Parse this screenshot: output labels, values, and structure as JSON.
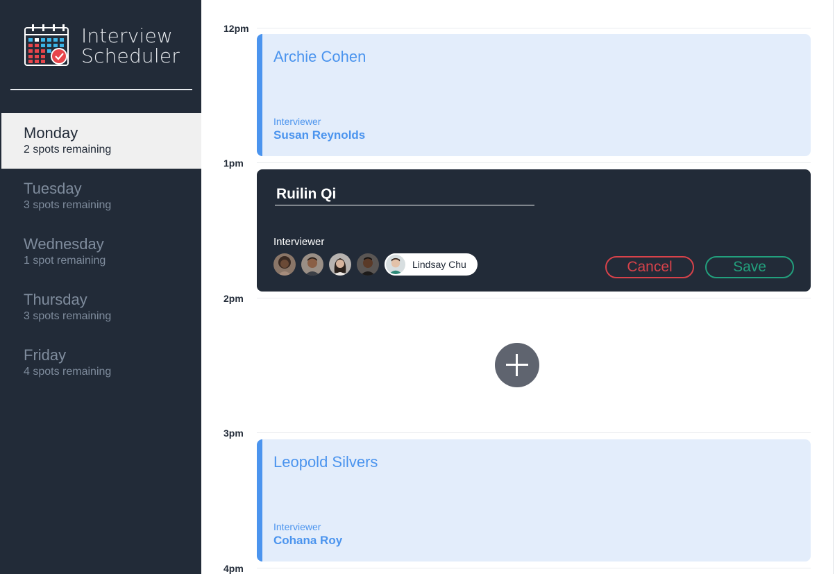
{
  "app": {
    "title_line1": "Interview",
    "title_line2": "Scheduler"
  },
  "days": [
    {
      "name": "Monday",
      "spots": "2 spots remaining",
      "selected": true
    },
    {
      "name": "Tuesday",
      "spots": "3 spots remaining",
      "selected": false
    },
    {
      "name": "Wednesday",
      "spots": "1 spot remaining",
      "selected": false
    },
    {
      "name": "Thursday",
      "spots": "3 spots remaining",
      "selected": false
    },
    {
      "name": "Friday",
      "spots": "4 spots remaining",
      "selected": false
    }
  ],
  "times": [
    "12pm",
    "1pm",
    "2pm",
    "3pm",
    "4pm"
  ],
  "appointments": {
    "noon": {
      "student": "Archie Cohen",
      "interviewer_label": "Interviewer",
      "interviewer": "Susan Reynolds"
    },
    "three": {
      "student": "Leopold Silvers",
      "interviewer_label": "Interviewer",
      "interviewer": "Cohana Roy"
    }
  },
  "form": {
    "student_value": "Ruilin Qi",
    "interviewer_label": "Interviewer",
    "selected_interviewer": "Lindsay Chu",
    "cancel_label": "Cancel",
    "save_label": "Save"
  },
  "icons": {
    "logo": "calendar-check-icon",
    "add": "plus-icon"
  },
  "colors": {
    "sidebar": "#222b38",
    "accent_blue": "#4b94ee",
    "appointment_bg": "#e3edfb",
    "cancel": "#d8424a",
    "save": "#22a07d",
    "add_button": "#5f646f"
  }
}
